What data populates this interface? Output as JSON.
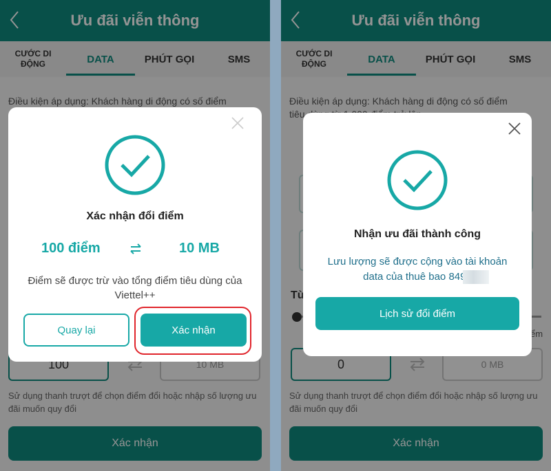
{
  "header": {
    "title": "Ưu đãi viễn thông"
  },
  "tabs": [
    {
      "label": "CƯỚC DI ĐỘNG"
    },
    {
      "label": "DATA"
    },
    {
      "label": "PHÚT GỌI"
    },
    {
      "label": "SMS"
    }
  ],
  "page": {
    "condition_line1": "Điều kiện áp dụng: Khách hàng di động có số điểm",
    "condition_line2": "tiêu dùng từ 1.000 điểm trở lên",
    "section_partial": "Từ",
    "points_input_left": "100",
    "points_input_right": "0",
    "mb_output": "10 MB",
    "mb_output_right": "0 MB",
    "truncated_edge": "ểm",
    "helper": "Sử dụng thanh trượt để chọn điểm đổi hoặc nhập số lượng ưu đãi muốn quy đổi",
    "confirm_button": "Xác nhận"
  },
  "confirm_modal": {
    "title": "Xác nhận đổi điểm",
    "points": "100 điểm",
    "data": "10 MB",
    "note": "Điểm sẽ được trừ vào tổng điểm tiêu dùng của Viettel++",
    "back_button": "Quay lại",
    "confirm_button": "Xác nhận"
  },
  "success_modal": {
    "title": "Nhận ưu đãi thành công",
    "note_line1": "Lưu lượng sẽ được cộng vào tài khoản",
    "note_line2": "data của thuê bao 8497",
    "history_button": "Lịch sử đổi điểm"
  },
  "colors": {
    "brand": "#0e8a7e",
    "accent": "#17a8a6",
    "highlight": "#e0242b"
  },
  "icons": {
    "back": "chevron-left-icon",
    "close": "close-icon",
    "success": "check-circle-icon",
    "swap": "swap-arrows-icon"
  }
}
